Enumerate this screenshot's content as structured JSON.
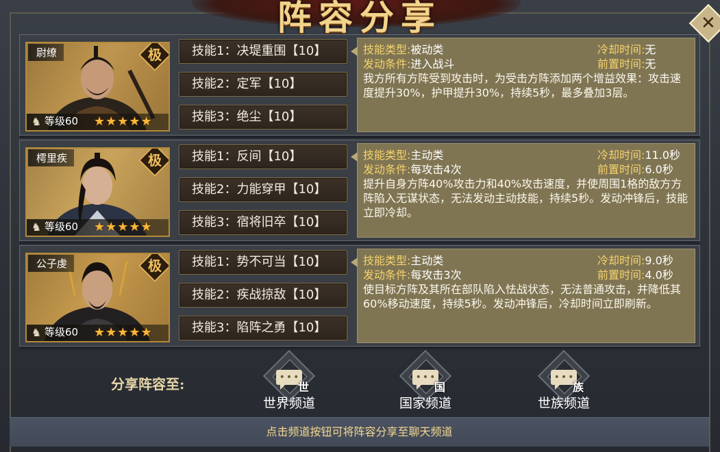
{
  "header": {
    "title": "阵容分享"
  },
  "close_icon": "close-icon",
  "heroes": [
    {
      "name": "尉缭",
      "badge": "极",
      "level": "等级60",
      "stars": "★★★★★",
      "skills": [
        "技能1：决堤重围【10】",
        "技能2：定军【10】",
        "技能3：绝尘【10】"
      ],
      "detail": {
        "type_key": "技能类型:",
        "type_val": "被动类",
        "cond_key": "发动条件:",
        "cond_val": "进入战斗",
        "cd_key": "冷却时间:",
        "cd_val": "无",
        "pre_key": "前置时间:",
        "pre_val": "无",
        "text": "我方所有方阵受到攻击时，为受击方阵添加两个增益效果：攻击速度提升30%，护甲提升30%，持续5秒，最多叠加3层。"
      }
    },
    {
      "name": "樗里疾",
      "badge": "极",
      "level": "等级60",
      "stars": "★★★★★",
      "skills": [
        "技能1：反间【10】",
        "技能2：力能穿甲【10】",
        "技能3：宿将旧卒【10】"
      ],
      "detail": {
        "type_key": "技能类型:",
        "type_val": "主动类",
        "cond_key": "发动条件:",
        "cond_val": "每攻击4次",
        "cd_key": "冷却时间:",
        "cd_val": "11.0秒",
        "pre_key": "前置时间:",
        "pre_val": "6.0秒",
        "text": "提升自身方阵40%攻击力和40%攻击速度，并使周围1格的敌方方阵陷入无谋状态，无法发动主动技能，持续5秒。发动冲锋后，技能立即冷却。"
      }
    },
    {
      "name": "公子虔",
      "badge": "极",
      "level": "等级60",
      "stars": "★★★★★",
      "skills": [
        "技能1：势不可当【10】",
        "技能2：疾战掠敌【10】",
        "技能3：陷阵之勇【10】"
      ],
      "detail": {
        "type_key": "技能类型:",
        "type_val": "主动类",
        "cond_key": "发动条件:",
        "cond_val": "每攻击3次",
        "cd_key": "冷却时间:",
        "cd_val": "9.0秒",
        "pre_key": "前置时间:",
        "pre_val": "4.0秒",
        "text": "使目标方阵及其所在部队陷入怯战状态，无法普通攻击，并降低其60%移动速度，持续5秒。发动冲锋后，冷却时间立即刷新。"
      }
    }
  ],
  "share": {
    "label": "分享阵容至:",
    "channels": [
      {
        "label": "世界频道",
        "icon_char": "世",
        "icon": "chat-bubble-icon"
      },
      {
        "label": "国家频道",
        "icon_char": "国",
        "icon": "chat-bubble-icon"
      },
      {
        "label": "世族频道",
        "icon_char": "族",
        "icon": "chat-bubble-icon"
      }
    ]
  },
  "footer": {
    "hint": "点击频道按钮可将阵容分享至聊天频道"
  }
}
